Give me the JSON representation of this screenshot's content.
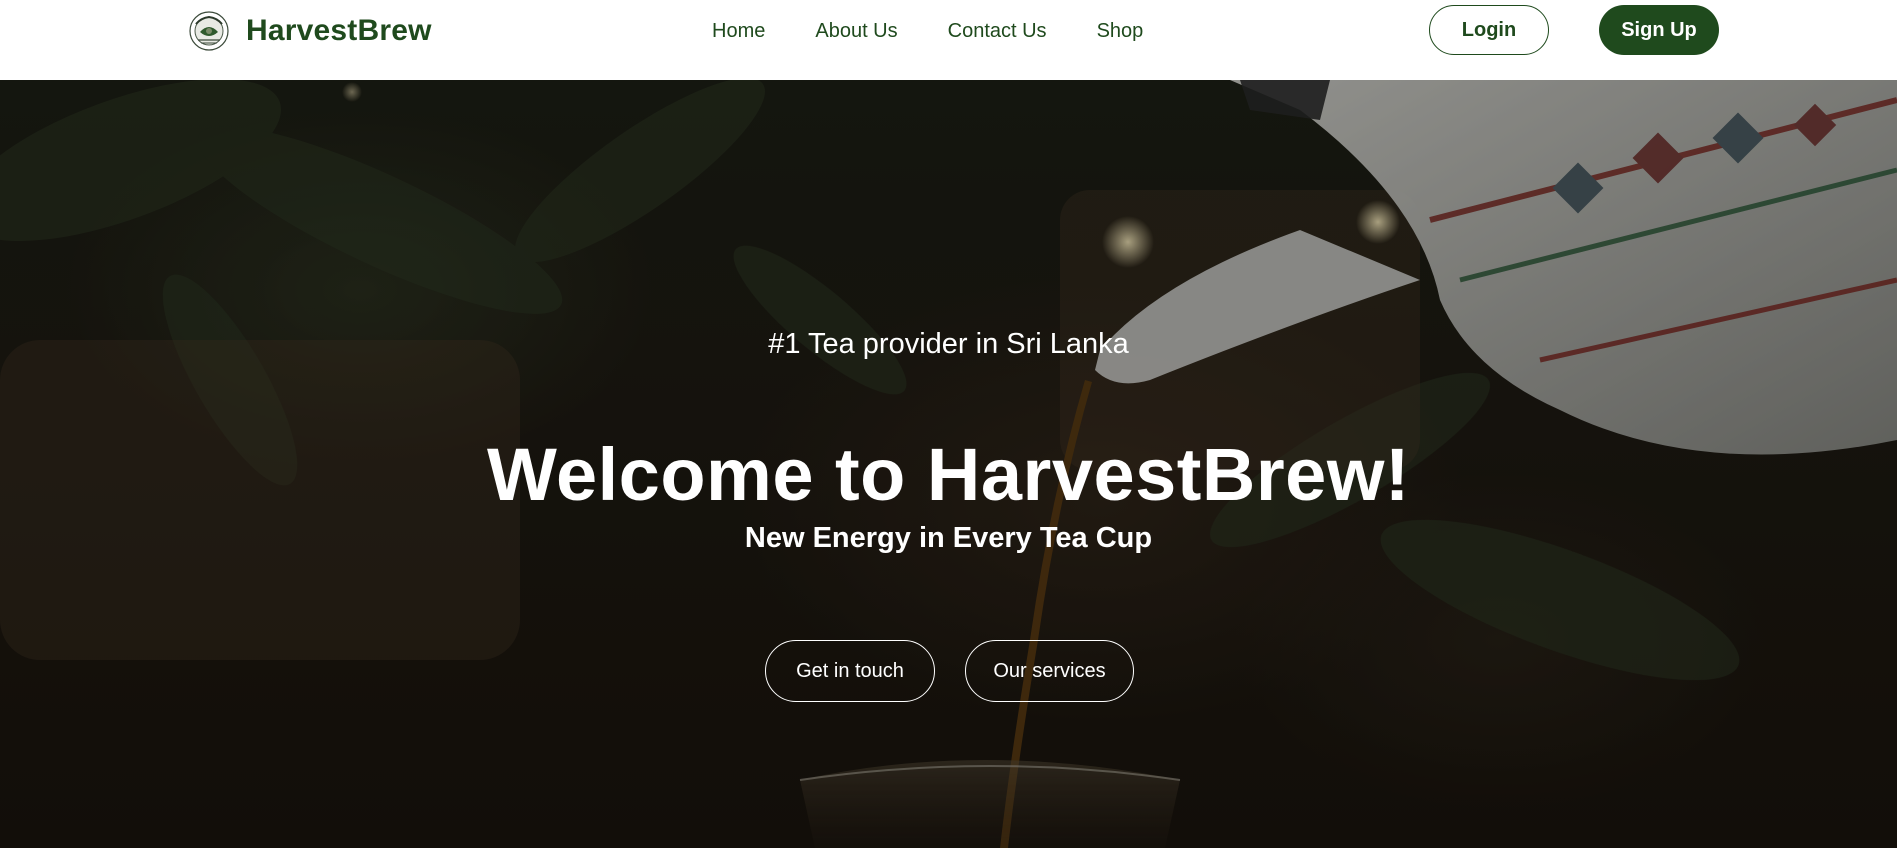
{
  "header": {
    "brand_name": "HarvestBrew",
    "logo_icon": "emblem-logo-icon",
    "nav": {
      "home": "Home",
      "about": "About Us",
      "contact": "Contact Us",
      "shop": "Shop"
    },
    "login_label": "Login",
    "signup_label": "Sign Up"
  },
  "hero": {
    "tagline": "#1 Tea provider in Sri Lanka",
    "title": "Welcome to HarvestBrew!",
    "subtitle": "New Energy in Every Tea Cup",
    "buttons": {
      "get_in_touch": "Get in touch",
      "our_services": "Our services"
    },
    "background_image": "teapot-pouring-tea-photo"
  },
  "colors": {
    "brand_green": "#1f4a1d",
    "header_bg": "#ffffff",
    "hero_text": "#ffffff"
  }
}
